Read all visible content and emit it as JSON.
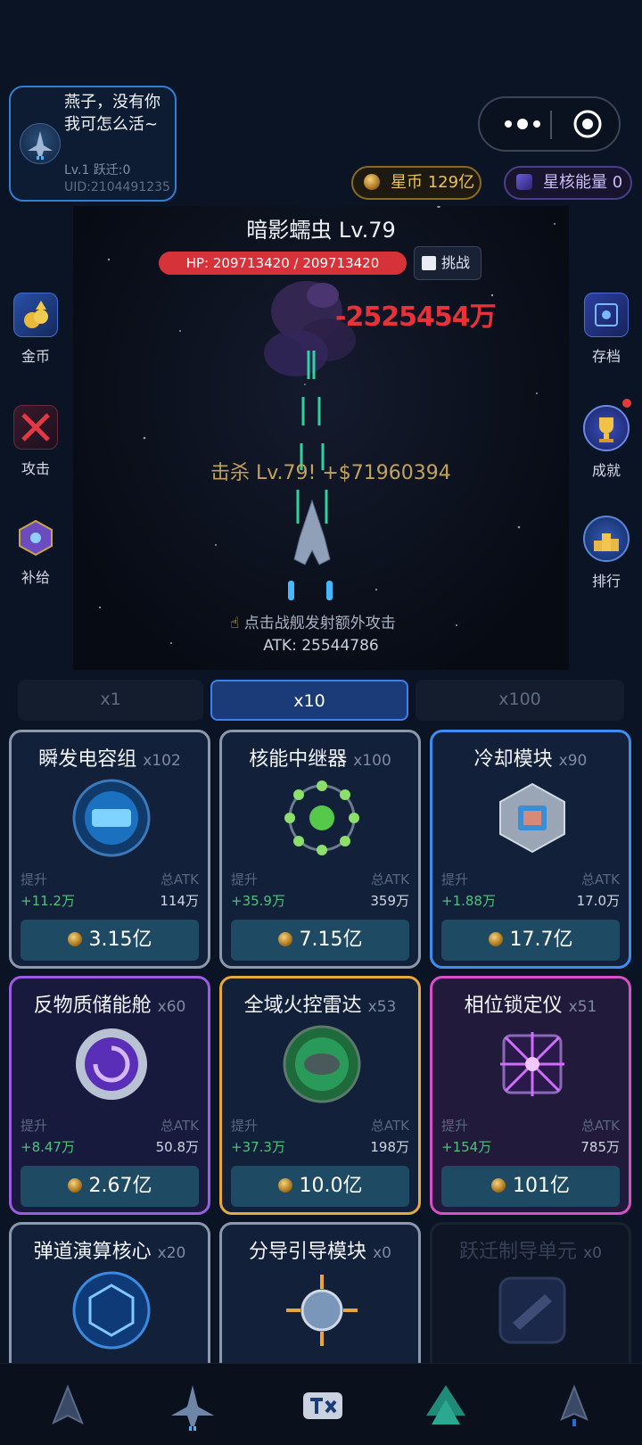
{
  "player": {
    "name": "燕子，没有你我可怎么活~",
    "level_line": "Lv.1 跃迁:0",
    "uid": "UID:2104491235"
  },
  "currency": {
    "coins_label": "星币 129亿",
    "energy_label": "星核能量 0"
  },
  "battle": {
    "boss_name": "暗影蠕虫 Lv.79",
    "hp_text": "HP: 209713420 / 209713420",
    "challenge_label": "挑战",
    "damage_text": "-2525454万",
    "kill_text": "击杀 Lv.79! +$71960394",
    "tap_hint": "点击战舰发射额外攻击",
    "atk_text": "ATK: 25544786"
  },
  "left_menu": [
    {
      "label": "金币",
      "icon": "gold-coins-icon"
    },
    {
      "label": "攻击",
      "icon": "crossed-swords-icon"
    },
    {
      "label": "补给",
      "icon": "supply-crate-icon"
    }
  ],
  "right_menu": [
    {
      "label": "存档",
      "icon": "save-disk-icon"
    },
    {
      "label": "成就",
      "icon": "trophy-icon"
    },
    {
      "label": "排行",
      "icon": "podium-icon"
    }
  ],
  "multipliers": [
    "x1",
    "x10",
    "x100"
  ],
  "active_multiplier": "x10",
  "modules": [
    {
      "name": "瞬发电容组",
      "count": "x102",
      "up_label": "提升",
      "total_label": "总ATK",
      "up": "+11.2万",
      "total": "114万",
      "cost": "3.15亿",
      "rarity": "common"
    },
    {
      "name": "核能中继器",
      "count": "x100",
      "up_label": "提升",
      "total_label": "总ATK",
      "up": "+35.9万",
      "total": "359万",
      "cost": "7.15亿",
      "rarity": "common"
    },
    {
      "name": "冷却模块",
      "count": "x90",
      "up_label": "提升",
      "total_label": "总ATK",
      "up": "+1.88万",
      "total": "17.0万",
      "cost": "17.7亿",
      "rarity": "rare"
    },
    {
      "name": "反物质储能舱",
      "count": "x60",
      "up_label": "提升",
      "total_label": "总ATK",
      "up": "+8.47万",
      "total": "50.8万",
      "cost": "2.67亿",
      "rarity": "epic"
    },
    {
      "name": "全域火控雷达",
      "count": "x53",
      "up_label": "提升",
      "total_label": "总ATK",
      "up": "+37.3万",
      "total": "198万",
      "cost": "10.0亿",
      "rarity": "legendary"
    },
    {
      "name": "相位锁定仪",
      "count": "x51",
      "up_label": "提升",
      "total_label": "总ATK",
      "up": "+154万",
      "total": "785万",
      "cost": "101亿",
      "rarity": "mythic"
    },
    {
      "name": "弹道演算核心",
      "count": "x20",
      "rarity": "common"
    },
    {
      "name": "分导引导模块",
      "count": "x0",
      "rarity": "common"
    },
    {
      "name": "跃迁制导单元",
      "count": "x0",
      "rarity": "locked"
    }
  ],
  "colors": {
    "background": "#0b1424",
    "hp_bar": "#d6323a",
    "damage": "#e8323a",
    "kill": "#c3a35a",
    "upgrade_green": "#4ec27b",
    "active_tab": "#1b3a78"
  }
}
